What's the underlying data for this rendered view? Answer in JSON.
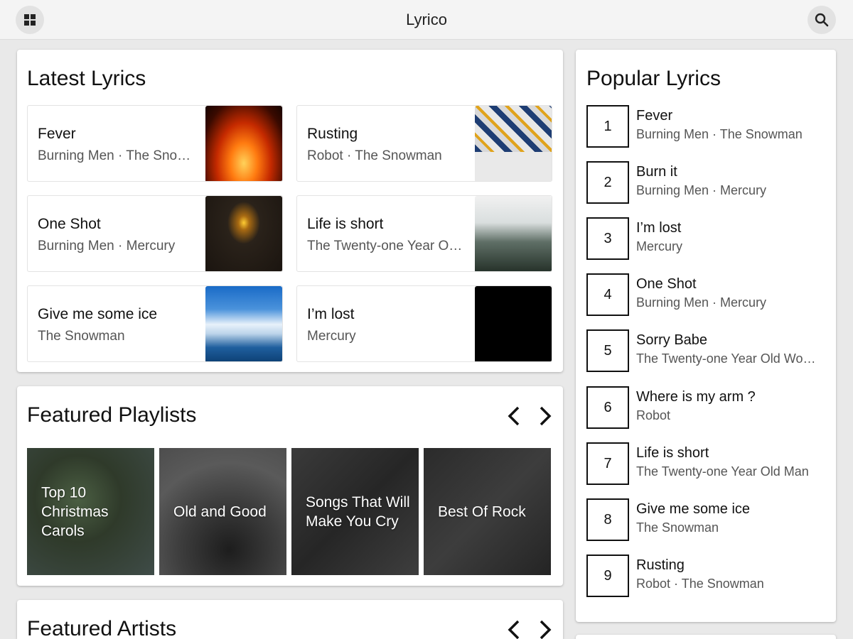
{
  "app": {
    "title": "Lyrico"
  },
  "topbar": {
    "menu_icon": "grid-icon",
    "search_icon": "search-icon"
  },
  "latest": {
    "title": "Latest Lyrics",
    "items": [
      {
        "title": "Fever",
        "subtitle": "Burning Men · The Snowman",
        "image": "fire"
      },
      {
        "title": "Rusting",
        "subtitle": "Robot · The Snowman",
        "image": "parts"
      },
      {
        "title": "One Shot",
        "subtitle": "Burning Men · Mercury",
        "image": "lighter"
      },
      {
        "title": "Life is short",
        "subtitle": "The Twenty-one Year Old Woman",
        "image": "forest"
      },
      {
        "title": "Give me some ice",
        "subtitle": "The Snowman",
        "image": "ice"
      },
      {
        "title": "I’m lost",
        "subtitle": "Mercury",
        "image": "dark"
      }
    ]
  },
  "playlists": {
    "title": "Featured Playlists",
    "items": [
      {
        "label": "Top 10 Christmas Carols"
      },
      {
        "label": "Old and Good"
      },
      {
        "label": "Songs That Will Make You Cry"
      },
      {
        "label": "Best Of Rock"
      }
    ]
  },
  "artists": {
    "title": "Featured Artists"
  },
  "popular": {
    "title": "Popular Lyrics",
    "items": [
      {
        "rank": "1",
        "title": "Fever",
        "subtitle": "Burning Men · The Snowman"
      },
      {
        "rank": "2",
        "title": "Burn it",
        "subtitle": "Burning Men · Mercury"
      },
      {
        "rank": "3",
        "title": "I’m lost",
        "subtitle": "Mercury"
      },
      {
        "rank": "4",
        "title": "One Shot",
        "subtitle": "Burning Men · Mercury"
      },
      {
        "rank": "5",
        "title": "Sorry Babe",
        "subtitle": "The Twenty-one Year Old Woman"
      },
      {
        "rank": "6",
        "title": "Where is my arm ?",
        "subtitle": "Robot"
      },
      {
        "rank": "7",
        "title": "Life is short",
        "subtitle": "The Twenty-one Year Old Man"
      },
      {
        "rank": "8",
        "title": "Give me some ice",
        "subtitle": "The Snowman"
      },
      {
        "rank": "9",
        "title": "Rusting",
        "subtitle": "Robot · The Snowman"
      }
    ]
  }
}
